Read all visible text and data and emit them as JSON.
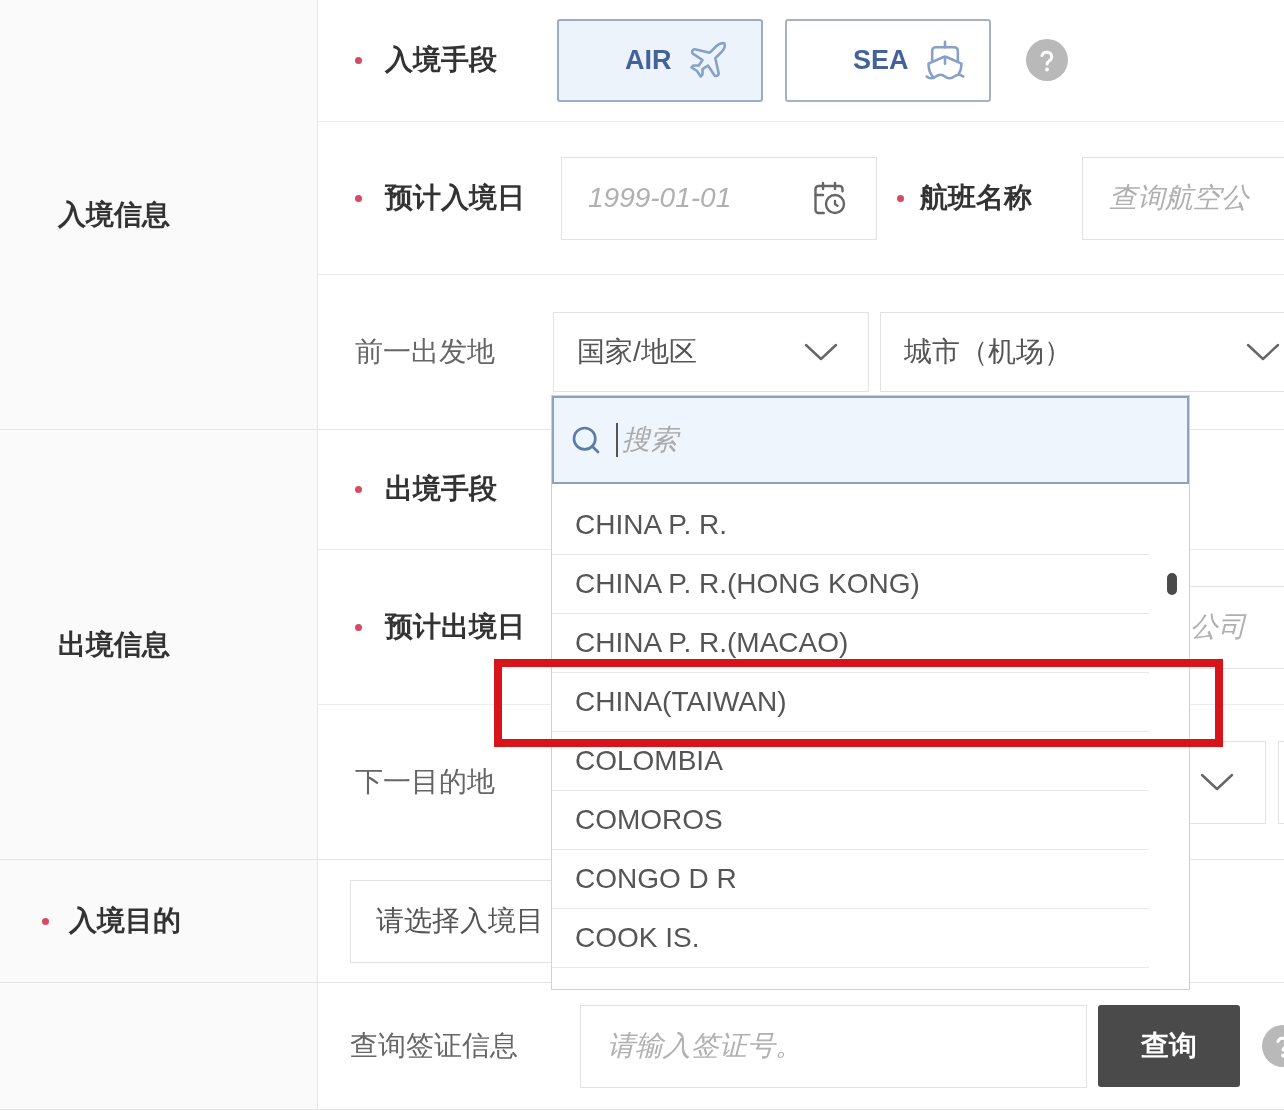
{
  "sections": [
    {
      "title": "入境信息",
      "required": false,
      "rows": [
        {
          "kind": "mode",
          "label": "入境手段",
          "required": true,
          "options": [
            {
              "label": "AIR",
              "selected": true
            },
            {
              "label": "SEA",
              "selected": false
            }
          ]
        },
        {
          "kind": "date-flight",
          "label": "预计入境日",
          "required": true,
          "date_placeholder": "1999-01-01",
          "flight_label": "航班名称",
          "flight_required": true,
          "flight_placeholder": "查询航空公"
        },
        {
          "kind": "place",
          "label": "前一出发地",
          "required": false,
          "country_placeholder": "国家/地区",
          "city_placeholder": "城市（机场）"
        }
      ]
    },
    {
      "title": "出境信息",
      "required": false,
      "rows": [
        {
          "kind": "covered",
          "label": "出境手段",
          "required": true
        },
        {
          "kind": "covered-field",
          "label": "预计出境日",
          "required": true,
          "placeholder": "公司"
        },
        {
          "kind": "covered-select",
          "label": "下一目的地",
          "required": false
        }
      ]
    },
    {
      "title": "入境目的",
      "required": true,
      "rows": [
        {
          "kind": "purpose",
          "placeholder": "请选择入境目"
        }
      ]
    },
    {
      "rows": [
        {
          "kind": "visa-query",
          "label": "查询签证信息",
          "required": false,
          "placeholder": "请输入签证号。",
          "button": "查询"
        }
      ]
    }
  ],
  "dropdown": {
    "search_placeholder": "搜索",
    "options": [
      {
        "label": "CHINA P. R.",
        "highlighted": false
      },
      {
        "label": "CHINA P. R.(HONG KONG)",
        "highlighted": false
      },
      {
        "label": "CHINA P. R.(MACAO)",
        "highlighted": false
      },
      {
        "label": "CHINA(TAIWAN)",
        "highlighted": true
      },
      {
        "label": "COLOMBIA",
        "highlighted": false
      },
      {
        "label": "COMOROS",
        "highlighted": false
      },
      {
        "label": "CONGO D R",
        "highlighted": false
      },
      {
        "label": "COOK IS.",
        "highlighted": false
      }
    ]
  }
}
